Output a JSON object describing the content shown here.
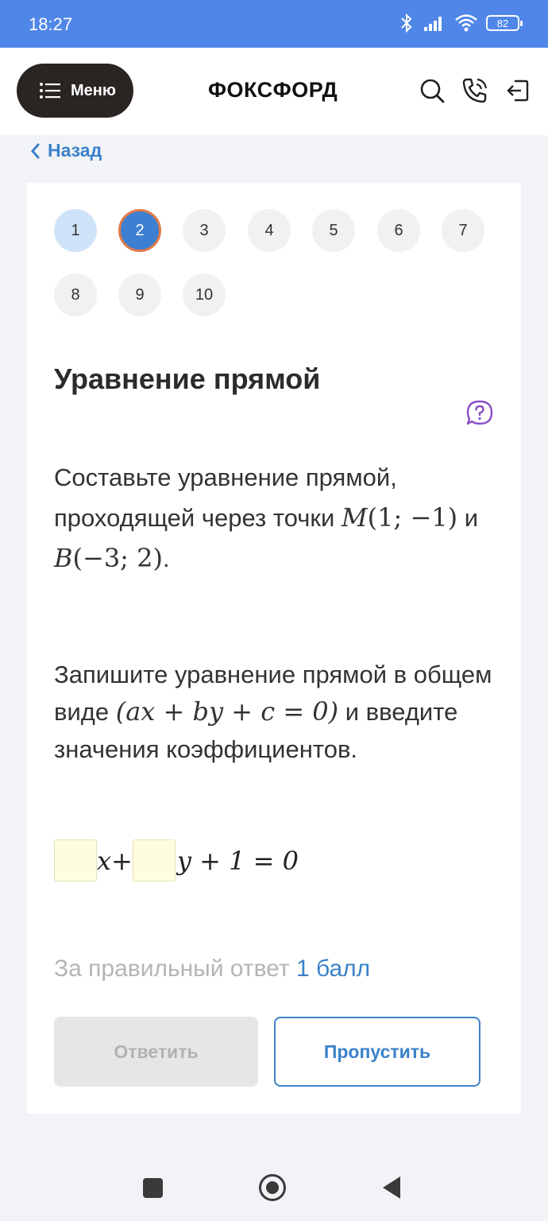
{
  "status_bar": {
    "time": "18:27",
    "battery": "82",
    "icons": [
      "bluetooth-icon",
      "signal-icon",
      "wifi-icon",
      "battery-icon"
    ]
  },
  "header": {
    "menu_label": "Меню",
    "logo": "ФОКСФОРД",
    "icons": [
      "search-icon",
      "phone-icon",
      "logout-icon"
    ]
  },
  "back_label": "Назад",
  "steps": [
    "1",
    "2",
    "3",
    "4",
    "5",
    "6",
    "7",
    "8",
    "9",
    "10"
  ],
  "current_step": "2",
  "task": {
    "title": "Уравнение прямой",
    "text1_a": "Составьте уравнение прямой, проходящей через точки ",
    "point_m_name": "M",
    "point_m_coords": "(1; −1)",
    "text1_and": " и ",
    "point_b_name": "B",
    "point_b_coords": "(−3; 2)",
    "text1_end": ".",
    "text2_a": "Запишите уравнение прямой в общем виде ",
    "general_form": "(ax + by + c = 0)",
    "text2_b": " и введите значения коэффициентов.",
    "eq_x": "x+",
    "eq_rest": "y + 1 = 0"
  },
  "score": {
    "prefix": "За правильный ответ ",
    "points": "1 балл"
  },
  "buttons": {
    "answer": "Ответить",
    "skip": "Пропустить"
  },
  "colors": {
    "status_bar": "#4f86e8",
    "accent": "#3b82c9",
    "current_step": "#3d7fd0",
    "current_step_border": "#e07b4a",
    "help_icon": "#8b4fc6",
    "input_bg": "#fffde0"
  }
}
